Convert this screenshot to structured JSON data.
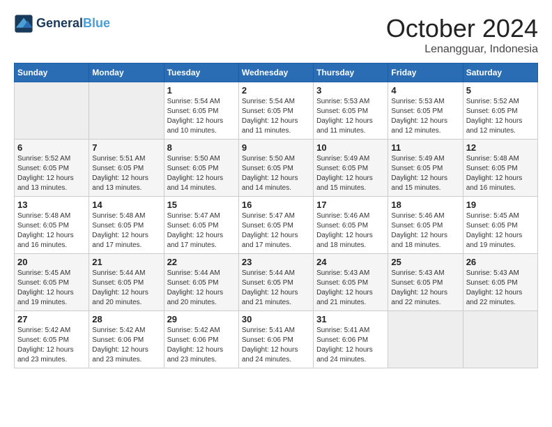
{
  "logo": {
    "line1": "General",
    "line2": "Blue"
  },
  "title": "October 2024",
  "subtitle": "Lenangguar, Indonesia",
  "days_of_week": [
    "Sunday",
    "Monday",
    "Tuesday",
    "Wednesday",
    "Thursday",
    "Friday",
    "Saturday"
  ],
  "weeks": [
    [
      {
        "day": "",
        "empty": true
      },
      {
        "day": "",
        "empty": true
      },
      {
        "day": "1",
        "sunrise": "5:54 AM",
        "sunset": "6:05 PM",
        "daylight": "12 hours and 10 minutes."
      },
      {
        "day": "2",
        "sunrise": "5:54 AM",
        "sunset": "6:05 PM",
        "daylight": "12 hours and 11 minutes."
      },
      {
        "day": "3",
        "sunrise": "5:53 AM",
        "sunset": "6:05 PM",
        "daylight": "12 hours and 11 minutes."
      },
      {
        "day": "4",
        "sunrise": "5:53 AM",
        "sunset": "6:05 PM",
        "daylight": "12 hours and 12 minutes."
      },
      {
        "day": "5",
        "sunrise": "5:52 AM",
        "sunset": "6:05 PM",
        "daylight": "12 hours and 12 minutes."
      }
    ],
    [
      {
        "day": "6",
        "sunrise": "5:52 AM",
        "sunset": "6:05 PM",
        "daylight": "12 hours and 13 minutes."
      },
      {
        "day": "7",
        "sunrise": "5:51 AM",
        "sunset": "6:05 PM",
        "daylight": "12 hours and 13 minutes."
      },
      {
        "day": "8",
        "sunrise": "5:50 AM",
        "sunset": "6:05 PM",
        "daylight": "12 hours and 14 minutes."
      },
      {
        "day": "9",
        "sunrise": "5:50 AM",
        "sunset": "6:05 PM",
        "daylight": "12 hours and 14 minutes."
      },
      {
        "day": "10",
        "sunrise": "5:49 AM",
        "sunset": "6:05 PM",
        "daylight": "12 hours and 15 minutes."
      },
      {
        "day": "11",
        "sunrise": "5:49 AM",
        "sunset": "6:05 PM",
        "daylight": "12 hours and 15 minutes."
      },
      {
        "day": "12",
        "sunrise": "5:48 AM",
        "sunset": "6:05 PM",
        "daylight": "12 hours and 16 minutes."
      }
    ],
    [
      {
        "day": "13",
        "sunrise": "5:48 AM",
        "sunset": "6:05 PM",
        "daylight": "12 hours and 16 minutes."
      },
      {
        "day": "14",
        "sunrise": "5:48 AM",
        "sunset": "6:05 PM",
        "daylight": "12 hours and 17 minutes."
      },
      {
        "day": "15",
        "sunrise": "5:47 AM",
        "sunset": "6:05 PM",
        "daylight": "12 hours and 17 minutes."
      },
      {
        "day": "16",
        "sunrise": "5:47 AM",
        "sunset": "6:05 PM",
        "daylight": "12 hours and 17 minutes."
      },
      {
        "day": "17",
        "sunrise": "5:46 AM",
        "sunset": "6:05 PM",
        "daylight": "12 hours and 18 minutes."
      },
      {
        "day": "18",
        "sunrise": "5:46 AM",
        "sunset": "6:05 PM",
        "daylight": "12 hours and 18 minutes."
      },
      {
        "day": "19",
        "sunrise": "5:45 AM",
        "sunset": "6:05 PM",
        "daylight": "12 hours and 19 minutes."
      }
    ],
    [
      {
        "day": "20",
        "sunrise": "5:45 AM",
        "sunset": "6:05 PM",
        "daylight": "12 hours and 19 minutes."
      },
      {
        "day": "21",
        "sunrise": "5:44 AM",
        "sunset": "6:05 PM",
        "daylight": "12 hours and 20 minutes."
      },
      {
        "day": "22",
        "sunrise": "5:44 AM",
        "sunset": "6:05 PM",
        "daylight": "12 hours and 20 minutes."
      },
      {
        "day": "23",
        "sunrise": "5:44 AM",
        "sunset": "6:05 PM",
        "daylight": "12 hours and 21 minutes."
      },
      {
        "day": "24",
        "sunrise": "5:43 AM",
        "sunset": "6:05 PM",
        "daylight": "12 hours and 21 minutes."
      },
      {
        "day": "25",
        "sunrise": "5:43 AM",
        "sunset": "6:05 PM",
        "daylight": "12 hours and 22 minutes."
      },
      {
        "day": "26",
        "sunrise": "5:43 AM",
        "sunset": "6:05 PM",
        "daylight": "12 hours and 22 minutes."
      }
    ],
    [
      {
        "day": "27",
        "sunrise": "5:42 AM",
        "sunset": "6:05 PM",
        "daylight": "12 hours and 23 minutes."
      },
      {
        "day": "28",
        "sunrise": "5:42 AM",
        "sunset": "6:06 PM",
        "daylight": "12 hours and 23 minutes."
      },
      {
        "day": "29",
        "sunrise": "5:42 AM",
        "sunset": "6:06 PM",
        "daylight": "12 hours and 23 minutes."
      },
      {
        "day": "30",
        "sunrise": "5:41 AM",
        "sunset": "6:06 PM",
        "daylight": "12 hours and 24 minutes."
      },
      {
        "day": "31",
        "sunrise": "5:41 AM",
        "sunset": "6:06 PM",
        "daylight": "12 hours and 24 minutes."
      },
      {
        "day": "",
        "empty": true
      },
      {
        "day": "",
        "empty": true
      }
    ]
  ]
}
